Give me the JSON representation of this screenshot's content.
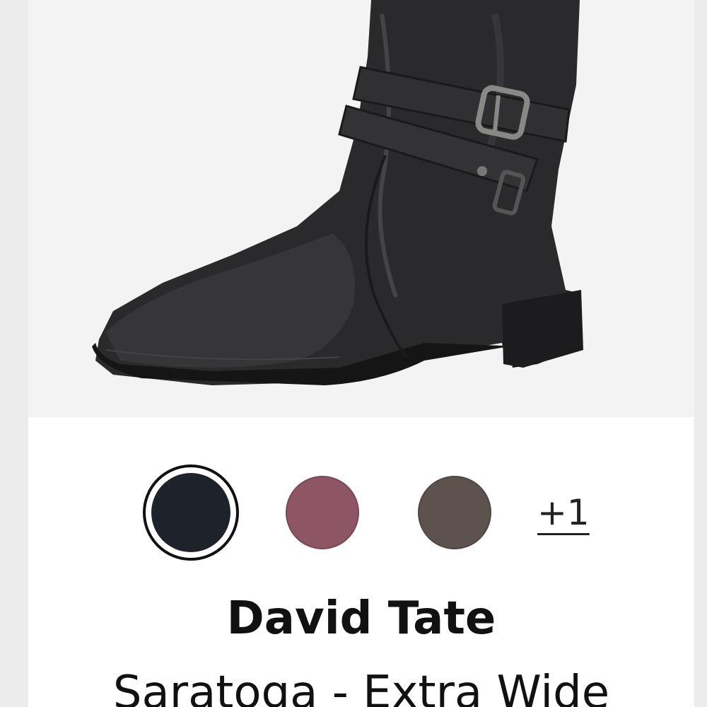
{
  "product": {
    "image_alt": "Black leather mid-calf boot with buckle straps",
    "brand": "David Tate",
    "name": "Saratoga - Extra Wide"
  },
  "swatches": [
    {
      "name": "black",
      "color": "#1e232b",
      "selected": true
    },
    {
      "name": "plum",
      "color": "#8e5564",
      "selected": false
    },
    {
      "name": "taupe",
      "color": "#5d524e",
      "selected": false
    }
  ],
  "more_colors_label": "+1"
}
